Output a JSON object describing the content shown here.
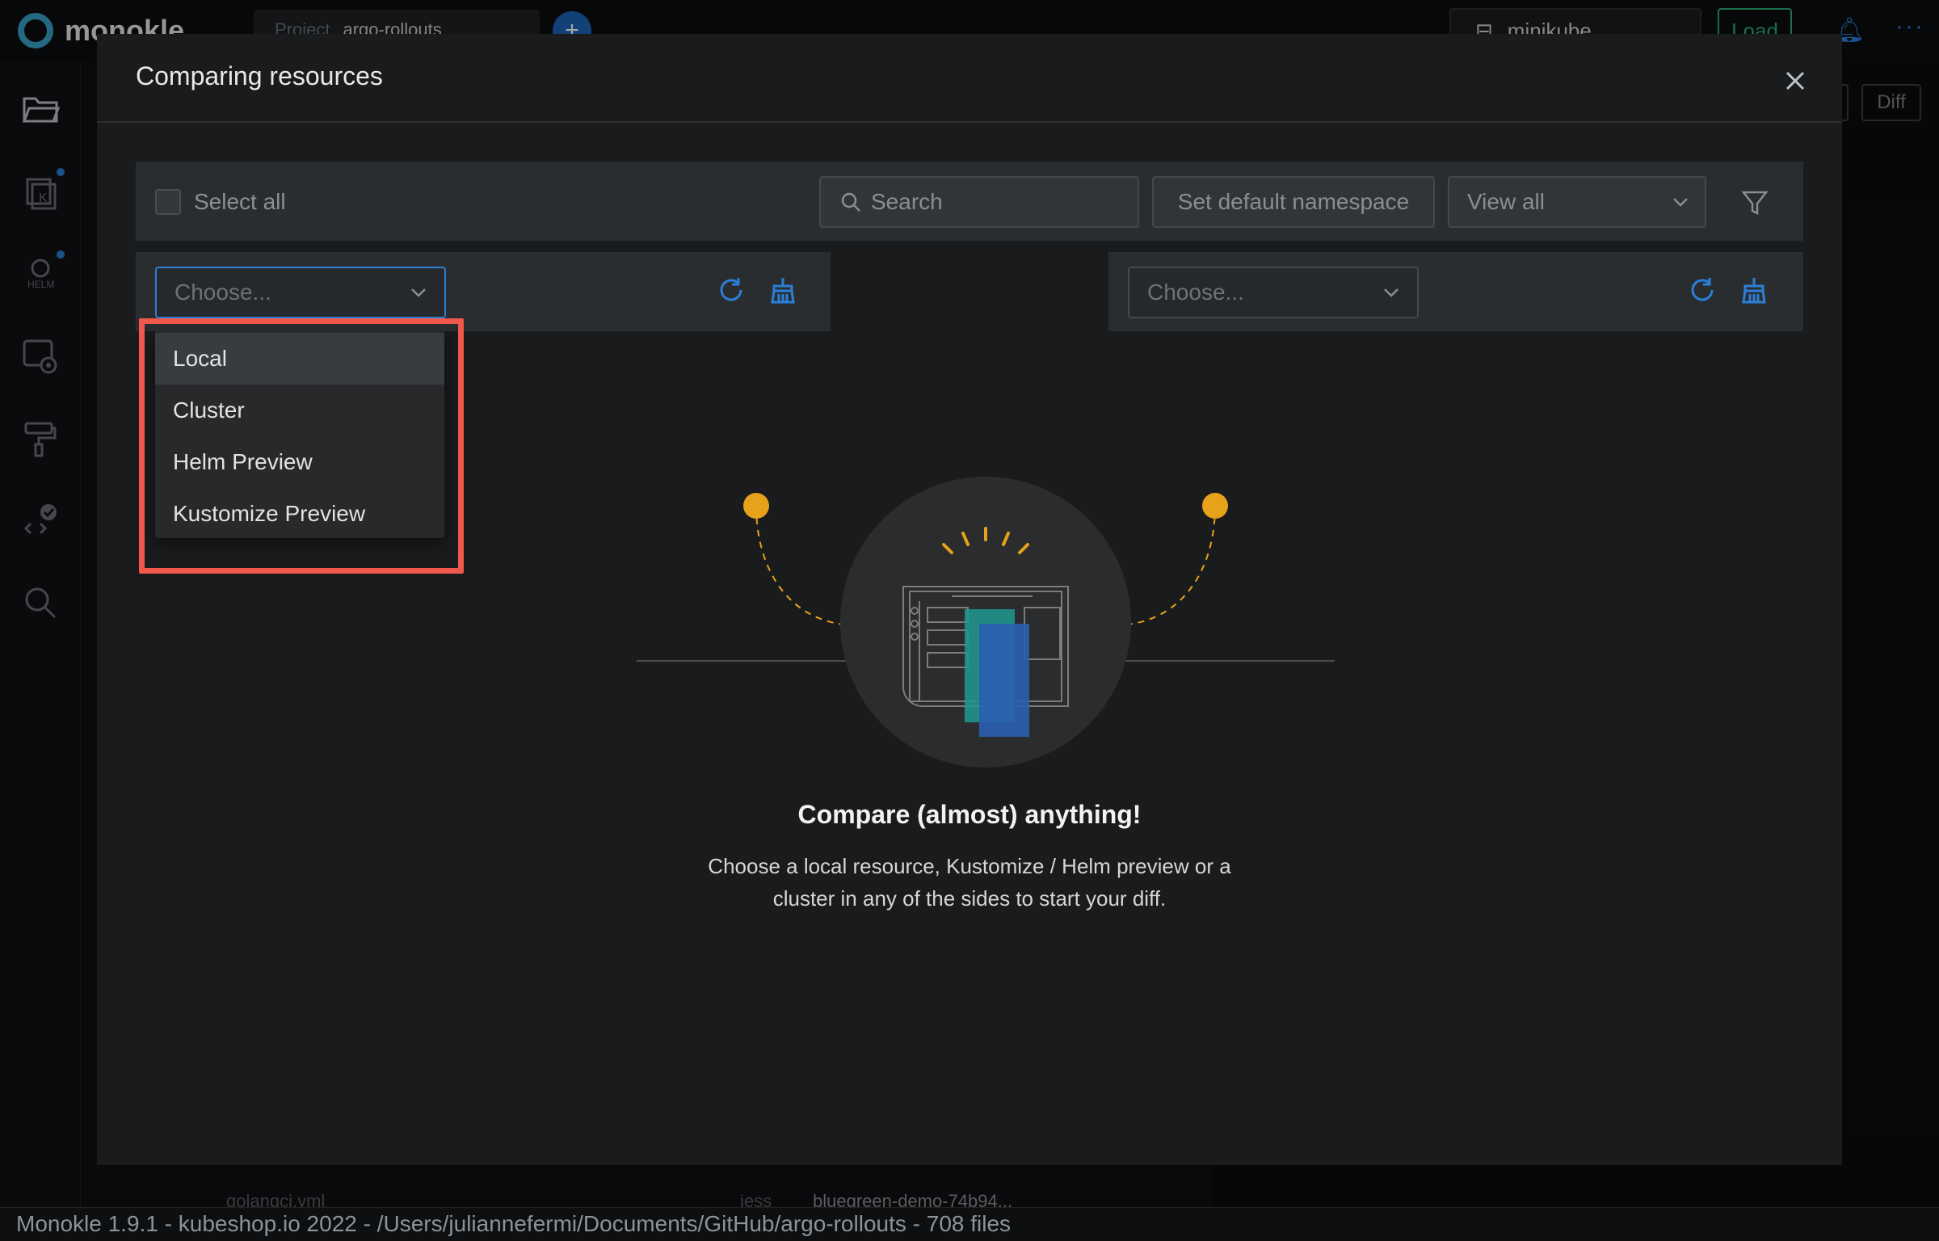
{
  "app": {
    "logo_text": "monokle",
    "project_key": "Project",
    "project_value": "argo-rollouts",
    "plus_label": "+",
    "cluster_name": "minikube",
    "load_label": "Load",
    "diff_label": "Diff"
  },
  "background_rows": [
    "golangci.yml",
    "iess",
    "bluegreen-demo-74b94..."
  ],
  "modal": {
    "title": "Comparing resources",
    "toolbar": {
      "select_all_label": "Select all",
      "search_placeholder": "Search",
      "namespace_button": "Set default namespace",
      "view_select": "View all"
    },
    "left": {
      "choose_placeholder": "Choose..."
    },
    "right": {
      "choose_placeholder": "Choose..."
    },
    "dropdown_options": [
      "Local",
      "Cluster",
      "Helm Preview",
      "Kustomize Preview"
    ],
    "empty_title": "Compare (almost) anything!",
    "empty_desc_line1": "Choose a local resource, Kustomize / Helm preview or a",
    "empty_desc_line2": "cluster in any of the sides to start your diff."
  },
  "status_bar": "Monokle 1.9.1 - kubeshop.io 2022 - /Users/juliannefermi/Documents/GitHub/argo-rollouts - 708 files",
  "colors": {
    "accent": "#2b7fd6",
    "highlight": "#f0584c",
    "illustration_orange": "#e5a21a",
    "load_green": "#2aa874"
  }
}
